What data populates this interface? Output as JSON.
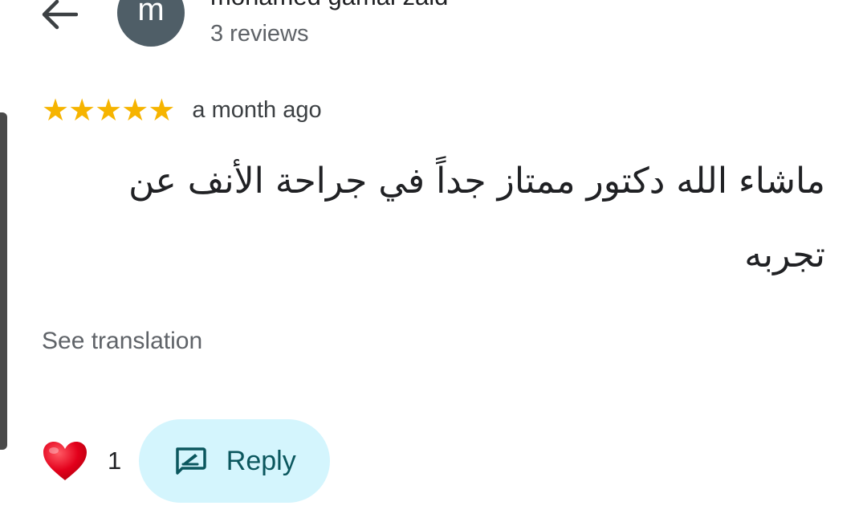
{
  "reviewer": {
    "avatar_initial": "m",
    "name": "mohamed gamal zaid",
    "reviews_count": "3 reviews"
  },
  "review": {
    "rating": 5,
    "rating_max": 5,
    "stars": [
      "★",
      "★",
      "★",
      "★",
      "★"
    ],
    "time": "a month ago",
    "text": "ماشاء الله دكتور ممتاز جداً في جراحة الأنف عن تجربه",
    "see_translation_label": "See translation"
  },
  "actions": {
    "like_count": "1",
    "reply_label": "Reply"
  },
  "colors": {
    "star": "#f6b400",
    "avatar_bg": "#4f5e67",
    "reply_bg": "#d4f5fd",
    "reply_fg": "#0b575e",
    "heart": "#e3001b"
  },
  "icons": {
    "back": "arrow-left-icon",
    "like": "heart-icon",
    "reply": "reply-edit-icon"
  }
}
